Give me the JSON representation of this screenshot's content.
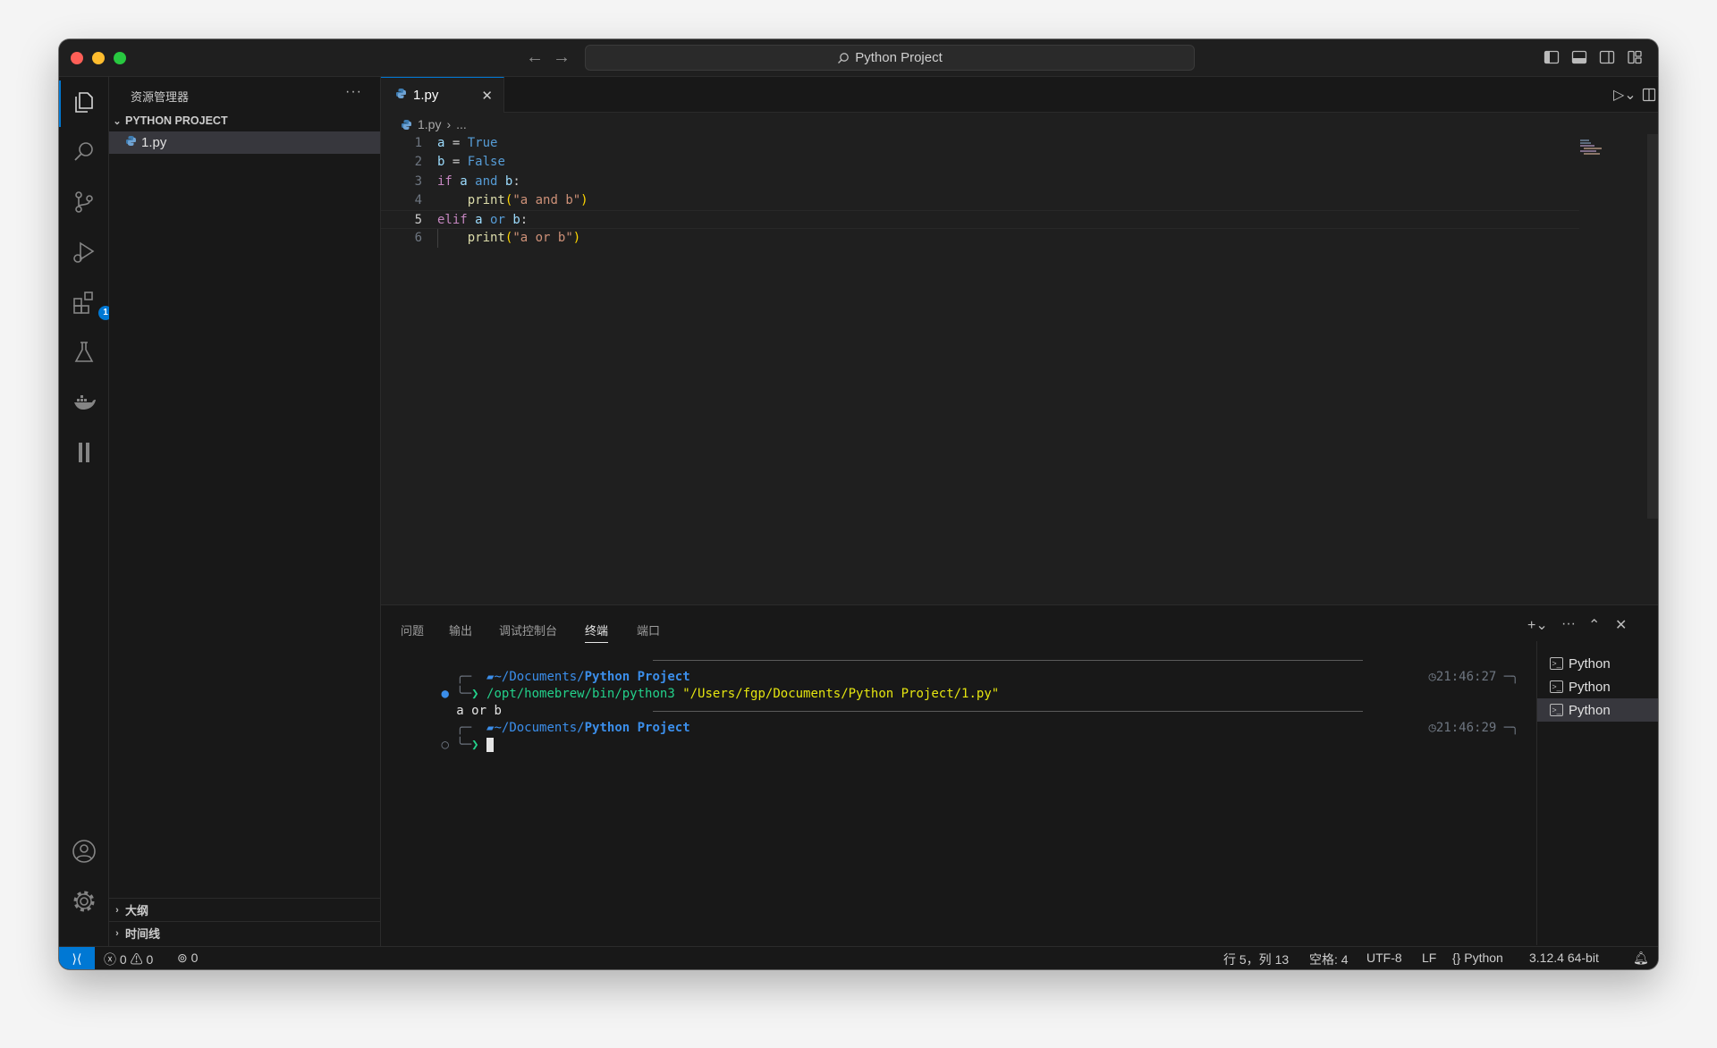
{
  "window": {
    "title": "Python Project"
  },
  "activity": {
    "extensions_badge": "1"
  },
  "sidebar": {
    "title": "资源管理器",
    "more": "···",
    "project": "PYTHON PROJECT",
    "file": "1.py",
    "outline": "大纲",
    "timeline": "时间线"
  },
  "editor": {
    "tab_label": "1.py",
    "breadcrumb_file": "1.py",
    "breadcrumb_more": "...",
    "line_numbers": [
      "1",
      "2",
      "3",
      "4",
      "5",
      "6"
    ],
    "code": {
      "l1_a": "a",
      "l1_eq": " = ",
      "l1_v": "True",
      "l2_b": "b",
      "l2_eq": " = ",
      "l2_v": "False",
      "l3_if": "if",
      "l3_a": "a",
      "l3_and": "and",
      "l3_b": "b",
      "l3_colon": ":",
      "l4_print": "print",
      "l4_lp": "(",
      "l4_str": "\"a and b\"",
      "l4_rp": ")",
      "l5_elif": "elif",
      "l5_a": "a",
      "l5_or": "or",
      "l5_b": "b",
      "l5_colon": ":",
      "l6_print": "print",
      "l6_lp": "(",
      "l6_str": "\"a or b\"",
      "l6_rp": ")"
    }
  },
  "panel": {
    "tabs": [
      "问题",
      "输出",
      "调试控制台",
      "终端",
      "端口"
    ],
    "active_tab": "终端",
    "terminal": {
      "prompt_path_prefix": "~/Documents/",
      "prompt_path_dir": "Python Project",
      "time1": "21:46:27",
      "command_bin": "/opt/homebrew/bin/python3",
      "command_arg": "\"/Users/fgp/Documents/Python Project/1.py\"",
      "output": "a or b",
      "time2": "21:46:29",
      "prompt_char": "❯"
    },
    "terminal_list": [
      "Python",
      "Python",
      "Python"
    ]
  },
  "status": {
    "errors": "0",
    "warnings": "0",
    "ports": "0",
    "position": "行 5，列 13",
    "spaces": "空格: 4",
    "encoding": "UTF-8",
    "eol": "LF",
    "language": "Python",
    "interpreter": "3.12.4 64-bit"
  },
  "colors": {
    "accent": "#0078d4",
    "keyword": "#c586c0",
    "boolean": "#569cd6",
    "string": "#ce9178"
  }
}
